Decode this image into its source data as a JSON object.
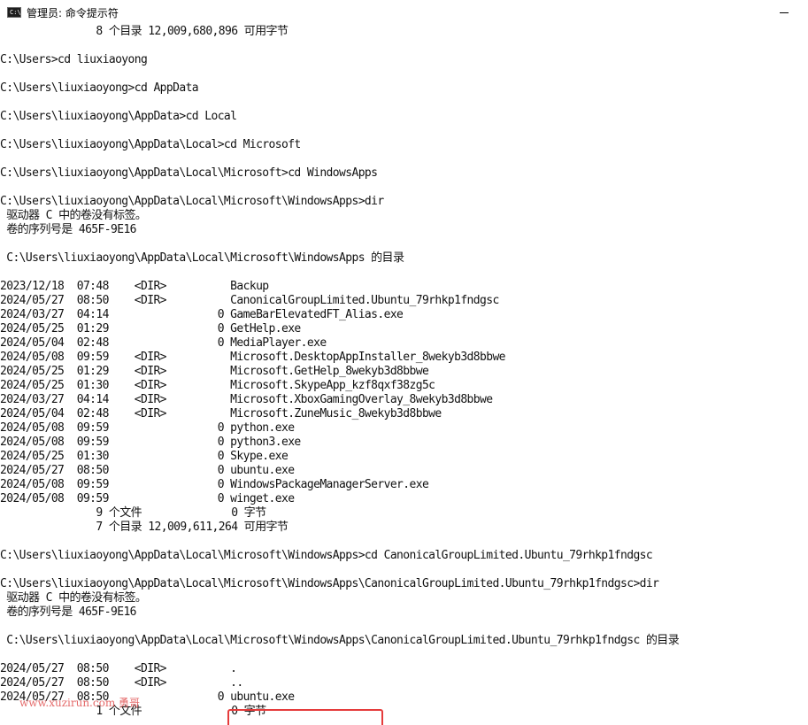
{
  "window": {
    "title": "管理员: 命令提示符",
    "icon": "cmd-icon"
  },
  "console": {
    "lines": [
      "               8 个目录 12,009,680,896 可用字节",
      "",
      "C:\\Users>cd liuxiaoyong",
      "",
      "C:\\Users\\liuxiaoyong>cd AppData",
      "",
      "C:\\Users\\liuxiaoyong\\AppData>cd Local",
      "",
      "C:\\Users\\liuxiaoyong\\AppData\\Local>cd Microsoft",
      "",
      "C:\\Users\\liuxiaoyong\\AppData\\Local\\Microsoft>cd WindowsApps",
      "",
      "C:\\Users\\liuxiaoyong\\AppData\\Local\\Microsoft\\WindowsApps>dir",
      " 驱动器 C 中的卷没有标签。",
      " 卷的序列号是 465F-9E16",
      "",
      " C:\\Users\\liuxiaoyong\\AppData\\Local\\Microsoft\\WindowsApps 的目录",
      "",
      "2023/12/18  07:48    <DIR>          Backup",
      "2024/05/27  08:50    <DIR>          CanonicalGroupLimited.Ubuntu_79rhkp1fndgsc",
      "2024/03/27  04:14                 0 GameBarElevatedFT_Alias.exe",
      "2024/05/25  01:29                 0 GetHelp.exe",
      "2024/05/04  02:48                 0 MediaPlayer.exe",
      "2024/05/08  09:59    <DIR>          Microsoft.DesktopAppInstaller_8wekyb3d8bbwe",
      "2024/05/25  01:29    <DIR>          Microsoft.GetHelp_8wekyb3d8bbwe",
      "2024/05/25  01:30    <DIR>          Microsoft.SkypeApp_kzf8qxf38zg5c",
      "2024/03/27  04:14    <DIR>          Microsoft.XboxGamingOverlay_8wekyb3d8bbwe",
      "2024/05/04  02:48    <DIR>          Microsoft.ZuneMusic_8wekyb3d8bbwe",
      "2024/05/08  09:59                 0 python.exe",
      "2024/05/08  09:59                 0 python3.exe",
      "2024/05/25  01:30                 0 Skype.exe",
      "2024/05/27  08:50                 0 ubuntu.exe",
      "2024/05/08  09:59                 0 WindowsPackageManagerServer.exe",
      "2024/05/08  09:59                 0 winget.exe",
      "               9 个文件              0 字节",
      "               7 个目录 12,009,611,264 可用字节",
      "",
      "C:\\Users\\liuxiaoyong\\AppData\\Local\\Microsoft\\WindowsApps>cd CanonicalGroupLimited.Ubuntu_79rhkp1fndgsc",
      "",
      "C:\\Users\\liuxiaoyong\\AppData\\Local\\Microsoft\\WindowsApps\\CanonicalGroupLimited.Ubuntu_79rhkp1fndgsc>dir",
      " 驱动器 C 中的卷没有标签。",
      " 卷的序列号是 465F-9E16",
      "",
      " C:\\Users\\liuxiaoyong\\AppData\\Local\\Microsoft\\WindowsApps\\CanonicalGroupLimited.Ubuntu_79rhkp1fndgsc 的目录",
      "",
      "2024/05/27  08:50    <DIR>          .",
      "2024/05/27  08:50    <DIR>          ..",
      "2024/05/27  08:50                 0 ubuntu.exe",
      "               1 个文件              0 字节"
    ]
  },
  "watermark": {
    "text": "www.xuzirun.com 勇哥"
  },
  "highlight": {
    "color": "#e53b3b"
  }
}
